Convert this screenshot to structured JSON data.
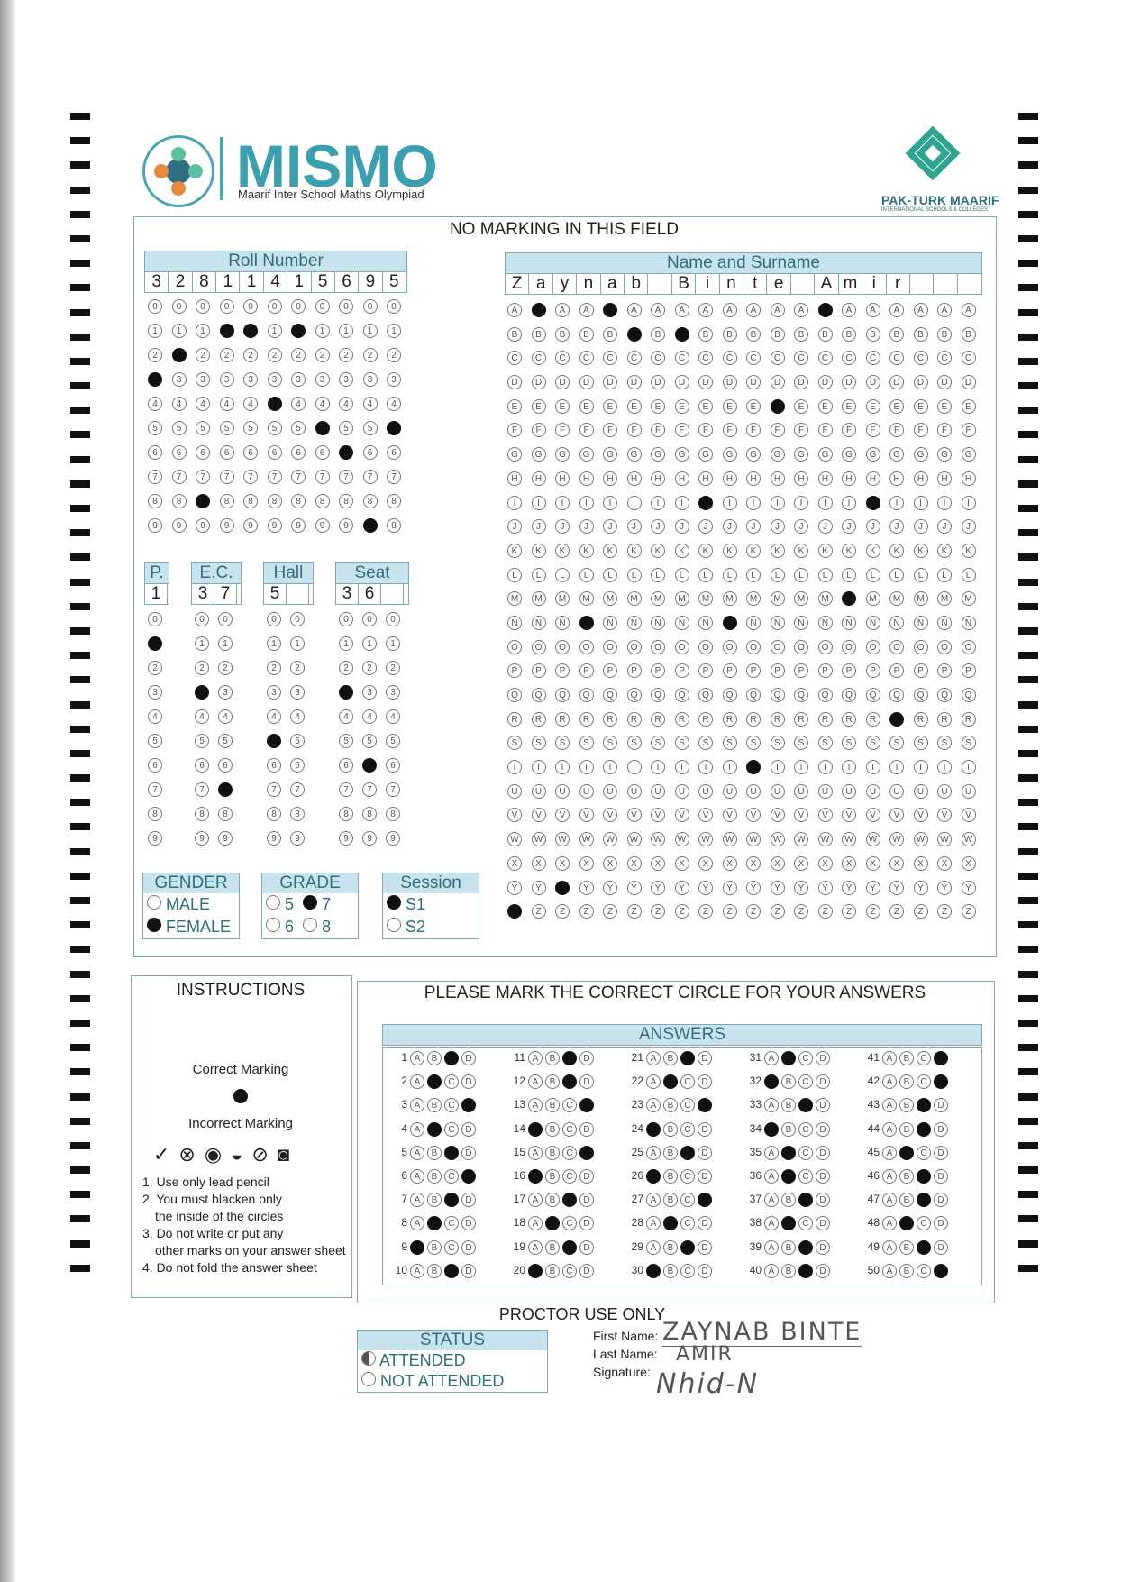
{
  "header": {
    "logo_title": "MISMO",
    "logo_subtitle": "Maarif Inter School Maths Olympiad",
    "right_logo_text": "PAK-TURK MAARIF",
    "right_logo_sub": "INTERNATIONAL SCHOOLS & COLLEGES",
    "no_marking": "NO MARKING IN THIS FIELD"
  },
  "roll": {
    "label": "Roll Number",
    "digits": [
      "3",
      "2",
      "8",
      "1",
      "1",
      "4",
      "1",
      "5",
      "6",
      "9",
      "5"
    ]
  },
  "name": {
    "label": "Name and Surname",
    "letters": [
      "Z",
      "a",
      "y",
      "n",
      "a",
      "b",
      "",
      "B",
      "i",
      "n",
      "t",
      "e",
      "",
      "A",
      "m",
      "i",
      "r",
      "",
      "",
      ""
    ]
  },
  "small_fields": {
    "p": {
      "label": "P.",
      "value": [
        "1"
      ]
    },
    "ec": {
      "label": "E.C.",
      "value": [
        "3",
        "7"
      ]
    },
    "hall": {
      "label": "Hall",
      "value": [
        "5",
        ""
      ]
    },
    "seat": {
      "label": "Seat",
      "value": [
        "3",
        "6",
        ""
      ]
    }
  },
  "gender": {
    "label": "GENDER",
    "options": [
      "MALE",
      "FEMALE"
    ],
    "selected": "FEMALE"
  },
  "grade": {
    "label": "GRADE",
    "options": [
      "5",
      "7",
      "6",
      "8"
    ],
    "selected": "7"
  },
  "session": {
    "label": "Session",
    "options": [
      "S1",
      "S2"
    ],
    "selected": "S1"
  },
  "instructions": {
    "title": "INSTRUCTIONS",
    "correct": "Correct Marking",
    "incorrect": "Incorrect Marking",
    "rules": [
      "1. Use only lead pencil",
      "2. You must blacken only",
      "the inside of the circles",
      "3. Do not write or put any",
      "other marks on your answer sheet",
      "4. Do not fold the answer sheet"
    ]
  },
  "answers_section": {
    "heading": "PLEASE MARK THE CORRECT CIRCLE FOR YOUR ANSWERS",
    "label": "ANSWERS",
    "marked": [
      "C",
      "B",
      "D",
      "B",
      "C",
      "D",
      "C",
      "B",
      "A",
      "C",
      "C",
      "C",
      "D",
      "A",
      "D",
      "A",
      "C",
      "B",
      "C",
      "A",
      "C",
      "B",
      "D",
      "A",
      "C",
      "A",
      "D",
      "B",
      "C",
      "A",
      "B",
      "A",
      "C",
      "A",
      "B",
      "B",
      "C",
      "B",
      "C",
      "C",
      "D",
      "D",
      "C",
      "C",
      "B",
      "C",
      "C",
      "B",
      "C",
      "D"
    ]
  },
  "proctor": {
    "title": "PROCTOR USE ONLY",
    "status_label": "STATUS",
    "attended": "ATTENDED",
    "not_attended": "NOT ATTENDED",
    "first_name_label": "First Name:",
    "last_name_label": "Last Name:",
    "signature_label": "Signature:",
    "first_name": "ZAYNAB BINTE",
    "last_name": "AMIR",
    "signature": "Nhid-N"
  }
}
